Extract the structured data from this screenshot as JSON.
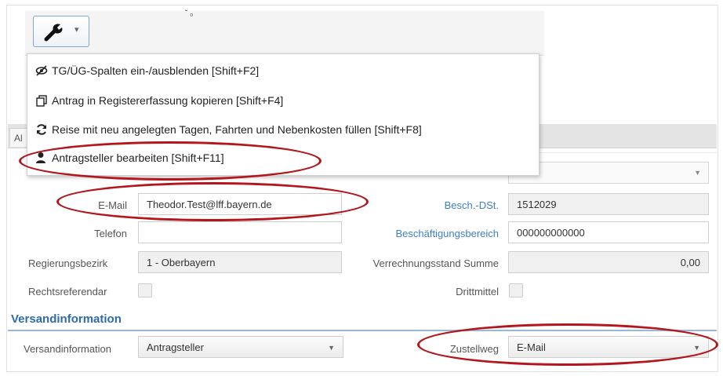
{
  "toolbar": {
    "tools_icon": "wrench-icon",
    "dropdown_caret": "▾",
    "stray_mark": "˘ ₀"
  },
  "menu": [
    {
      "icon": "eye-slash-icon",
      "label": "TG/ÜG-Spalten ein-/ausblenden [Shift+F2]"
    },
    {
      "icon": "copy-icon",
      "label": "Antrag in Registererfassung kopieren [Shift+F4]"
    },
    {
      "icon": "refresh-icon",
      "label": "Reise mit neu angelegten Tagen, Fahrten und Nebenkosten füllen [Shift+F8]"
    },
    {
      "icon": "user-icon",
      "label": "Antragsteller bearbeiten [Shift+F11]"
    }
  ],
  "tab_stub": "Al",
  "form": {
    "email_label": "E-Mail",
    "email_value": "Theodor.Test@lff.bayern.de",
    "telefon_label": "Telefon",
    "telefon_value": "",
    "regierungsbezirk_label": "Regierungsbezirk",
    "regierungsbezirk_value": "1 - Oberbayern",
    "rechtsreferendar_label": "Rechtsreferendar",
    "besch_dst_label": "Besch.-DSt.",
    "besch_dst_value": "1512029",
    "beschaeftigungsbereich_label": "Beschäftigungsbereich",
    "beschaeftigungsbereich_value": "000000000000",
    "verrechnungsstand_label": "Verrechnungsstand Summe",
    "verrechnungsstand_value": "0,00",
    "drittmittel_label": "Drittmittel"
  },
  "versand": {
    "section_title": "Versandinformation",
    "versandinformation_label": "Versandinformation",
    "versandinformation_value": "Antragsteller",
    "zustellweg_label": "Zustellweg",
    "zustellweg_value": "E-Mail"
  },
  "annotation_color": "#b3171d"
}
